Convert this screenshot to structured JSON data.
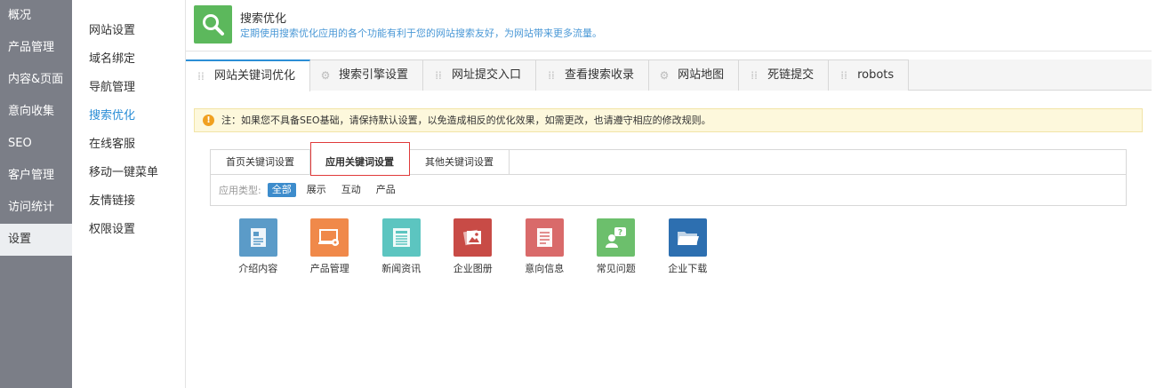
{
  "leftnav": {
    "items": [
      {
        "label": "概况"
      },
      {
        "label": "产品管理"
      },
      {
        "label": "内容&页面"
      },
      {
        "label": "意向收集"
      },
      {
        "label": "SEO"
      },
      {
        "label": "客户管理"
      },
      {
        "label": "访问统计"
      },
      {
        "label": "设置",
        "active": true
      }
    ]
  },
  "subnav": {
    "items": [
      {
        "label": "网站设置"
      },
      {
        "label": "域名绑定"
      },
      {
        "label": "导航管理"
      },
      {
        "label": "搜索优化",
        "active": true
      },
      {
        "label": "在线客服"
      },
      {
        "label": "移动一键菜单"
      },
      {
        "label": "友情链接"
      },
      {
        "label": "权限设置"
      }
    ]
  },
  "header": {
    "title": "搜索优化",
    "desc": "定期使用搜索优化应用的各个功能有利于您的网站搜索友好，为网站带来更多流量。",
    "logo_color": "#5cb85c",
    "logo_icon": "search-icon"
  },
  "tabs": [
    {
      "label": "网站关键词优化",
      "icon": "grid-icon",
      "active": true
    },
    {
      "label": "搜索引擎设置",
      "icon": "gear-icon"
    },
    {
      "label": "网址提交入口",
      "icon": "grid-icon"
    },
    {
      "label": "查看搜索收录",
      "icon": "grid-icon"
    },
    {
      "label": "网站地图",
      "icon": "gear-icon"
    },
    {
      "label": "死链提交",
      "icon": "grid-icon"
    },
    {
      "label": "robots",
      "icon": "grid-icon"
    }
  ],
  "notice": {
    "text": "注：如果您不具备SEO基础，请保持默认设置，以免造成相反的优化效果，如需更改，也请遵守相应的修改规则。"
  },
  "panel": {
    "tabs": [
      {
        "label": "首页关键词设置"
      },
      {
        "label": "应用关键词设置",
        "active": true
      },
      {
        "label": "其他关键词设置"
      }
    ],
    "filter_label": "应用类型:",
    "filters": [
      {
        "label": "全部",
        "active": true
      },
      {
        "label": "展示"
      },
      {
        "label": "互动"
      },
      {
        "label": "产品"
      }
    ]
  },
  "apps": [
    {
      "label": "介绍内容",
      "color": "#5b9bc8",
      "icon": "document-icon"
    },
    {
      "label": "产品管理",
      "color": "#f0894a",
      "icon": "laptop-gear-icon"
    },
    {
      "label": "新闻资讯",
      "color": "#5cc5c0",
      "icon": "newspaper-icon"
    },
    {
      "label": "企业图册",
      "color": "#c84b46",
      "icon": "photo-album-icon"
    },
    {
      "label": "意向信息",
      "color": "#d96a6a",
      "icon": "form-icon"
    },
    {
      "label": "常见问题",
      "color": "#6cbf6c",
      "icon": "question-user-icon"
    },
    {
      "label": "企业下载",
      "color": "#2d6fb0",
      "icon": "folder-icon"
    }
  ]
}
